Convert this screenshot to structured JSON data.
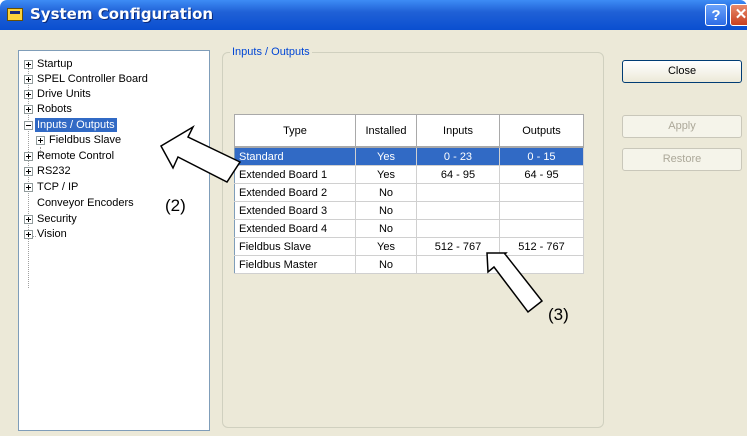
{
  "window": {
    "title": "System Configuration",
    "help_glyph": "?",
    "close_glyph": "✕"
  },
  "tree": {
    "items": [
      {
        "label": "Startup"
      },
      {
        "label": "SPEL Controller Board"
      },
      {
        "label": "Drive Units"
      },
      {
        "label": "Robots"
      },
      {
        "label": "Inputs / Outputs"
      },
      {
        "label": "Fieldbus Slave"
      },
      {
        "label": "Remote Control"
      },
      {
        "label": "RS232"
      },
      {
        "label": "TCP / IP"
      },
      {
        "label": "Conveyor Encoders"
      },
      {
        "label": "Security"
      },
      {
        "label": "Vision"
      }
    ],
    "selected": "Inputs / Outputs"
  },
  "group": {
    "title": "Inputs / Outputs"
  },
  "table": {
    "headers": [
      "Type",
      "Installed",
      "Inputs",
      "Outputs"
    ],
    "rows": [
      [
        "Standard",
        "Yes",
        "0 - 23",
        "0 - 15"
      ],
      [
        "Extended Board 1",
        "Yes",
        "64 - 95",
        "64 - 95"
      ],
      [
        "Extended Board 2",
        "No",
        "",
        ""
      ],
      [
        "Extended Board 3",
        "No",
        "",
        ""
      ],
      [
        "Extended Board 4",
        "No",
        "",
        ""
      ],
      [
        "Fieldbus Slave",
        "Yes",
        "512 - 767",
        "512 - 767"
      ],
      [
        "Fieldbus Master",
        "No",
        "",
        ""
      ]
    ],
    "selected_row": 0
  },
  "buttons": {
    "close": "Close",
    "apply": "Apply",
    "restore": "Restore"
  },
  "callouts": {
    "tree": "(2)",
    "table": "(3)"
  },
  "colors": {
    "selection": "#316ac5",
    "title_bar": "#0a4fd0",
    "group_title": "#0046d5"
  }
}
